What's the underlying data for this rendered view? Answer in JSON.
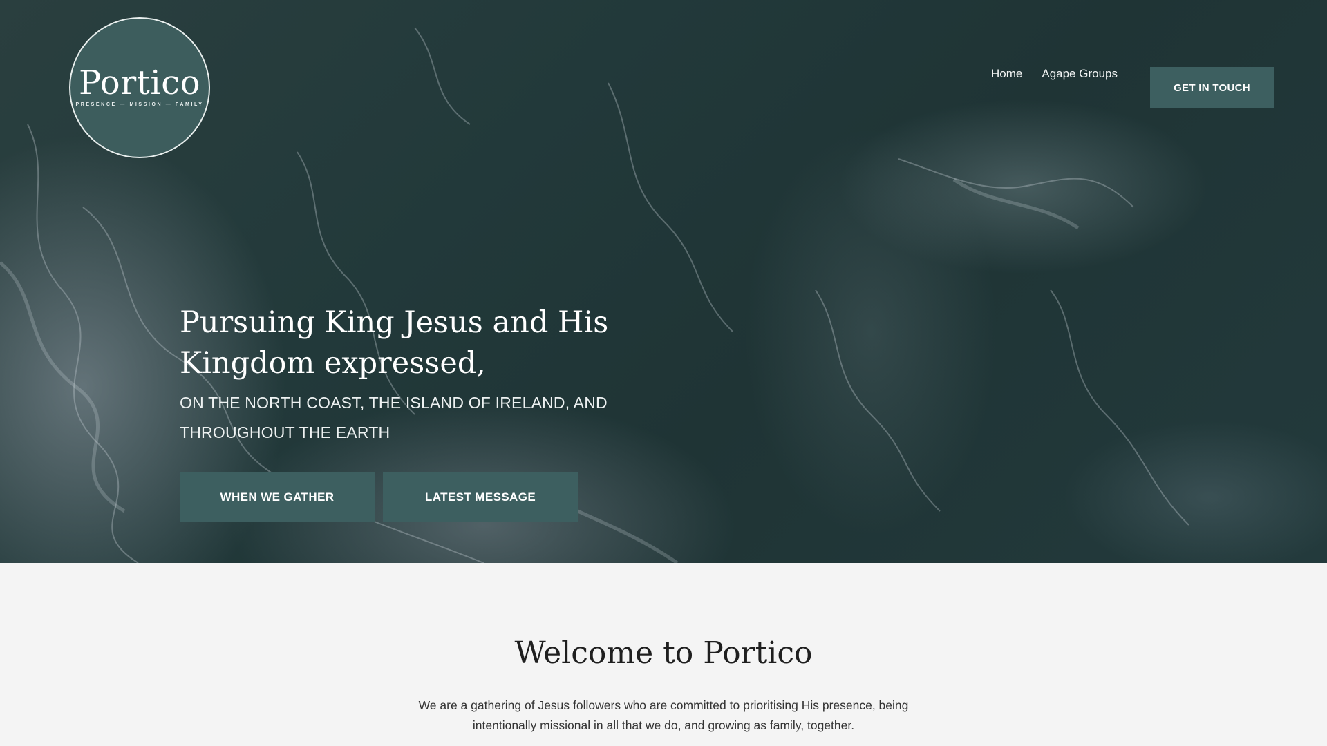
{
  "header": {
    "logo": {
      "wordmark": "Portico",
      "tagline": "PRESENCE — MISSION — FAMILY"
    },
    "nav": [
      {
        "label": "Home",
        "active": true
      },
      {
        "label": "Agape Groups",
        "active": false
      }
    ],
    "cta_label": "GET IN TOUCH"
  },
  "hero": {
    "headline": "Pursuing King Jesus and His Kingdom expressed,",
    "subline": "ON THE NORTH COAST, THE ISLAND OF IRELAND, AND THROUGHOUT THE EARTH",
    "buttons": [
      {
        "label": "WHEN WE GATHER"
      },
      {
        "label": "LATEST MESSAGE"
      }
    ]
  },
  "welcome": {
    "title": "Welcome to Portico",
    "body": "We are a gathering of Jesus followers who are committed to prioritising His presence, being intentionally missional in all that we do, and growing as family, together."
  },
  "colors": {
    "accent": "#3d5f60",
    "hero_background": "#22393a",
    "page_background": "#f4f4f4"
  }
}
